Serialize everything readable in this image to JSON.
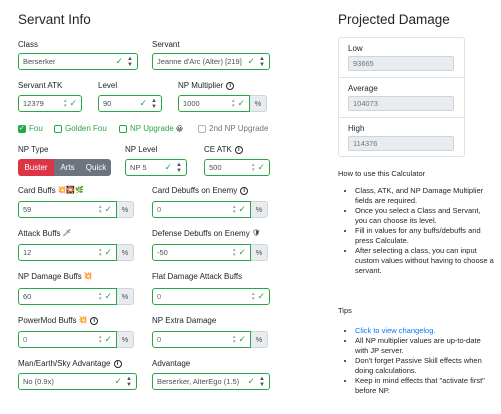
{
  "servant_info": {
    "heading": "Servant Info",
    "class_label": "Class",
    "class_value": "Berserker",
    "servant_label": "Servant",
    "servant_value": "Jeanne d'Arc (Alter) [219]",
    "atk_label": "Servant ATK",
    "atk_value": "12379",
    "level_label": "Level",
    "level_value": "90",
    "np_mult_label": "NP Multiplier",
    "np_mult_value": "1000",
    "fou_label": "Fou",
    "golden_fou_label": "Golden Fou",
    "np_upgrade_label": "NP Upgrade",
    "second_np_upgrade_label": "2nd NP Upgrade",
    "np_type_label": "NP Type",
    "np_types": [
      "Buster",
      "Arts",
      "Quick"
    ],
    "np_level_label": "NP Level",
    "np_level_value": "NP 5",
    "ce_atk_label": "CE ATK",
    "ce_atk_value": "500",
    "card_buffs_label": "Card Buffs",
    "card_buffs_value": "59",
    "card_debuffs_label": "Card Debuffs on Enemy",
    "card_debuffs_value": "0",
    "attack_buffs_label": "Attack Buffs",
    "attack_buffs_value": "12",
    "defense_debuffs_label": "Defense Debuffs on Enemy",
    "defense_debuffs_value": "-50",
    "np_damage_buffs_label": "NP Damage Buffs",
    "np_damage_buffs_value": "60",
    "flat_damage_label": "Flat Damage Attack Buffs",
    "flat_damage_value": "0",
    "powermod_label": "PowerMod Buffs",
    "powermod_value": "0",
    "np_extra_damage_label": "NP Extra Damage",
    "np_extra_damage_value": "0",
    "advantage_mesa_label": "Man/Earth/Sky Advantage",
    "advantage_mesa_value": "No (0.9x)",
    "advantage_label": "Advantage",
    "advantage_value": "Berserker, AlterEgo (1.5)",
    "percent": "%",
    "info_glyph": "i"
  },
  "projected": {
    "heading": "Projected Damage",
    "low_label": "Low",
    "low_value": "93665",
    "avg_label": "Average",
    "avg_value": "104073",
    "high_label": "High",
    "high_value": "114376"
  },
  "howto": {
    "heading": "How to use this Calculator",
    "items": [
      "Class, ATK, and NP Damage Multiplier fields are required.",
      "Once you select a Class and Servant, you can choose its level.",
      "Fill in values for any buffs/debuffs and press Calculate.",
      "After selecting a class, you can input custom values without having to choose a servant."
    ]
  },
  "tips": {
    "heading": "Tips",
    "link": "Click to view changelog.",
    "items": [
      "All NP multiplier values are up-to-date with JP server.",
      "Don't forget Passive Skill effects when doing calculations.",
      "Keep in mind effects that \"activate first\" before NP."
    ]
  },
  "colors": {
    "valid_border": "#28a745",
    "buster": "#dc3545",
    "arts_quick": "#6c757d",
    "link": "#007bff"
  },
  "icons": [
    "check-icon",
    "caret-icon",
    "info-icon",
    "spinner-icon"
  ]
}
